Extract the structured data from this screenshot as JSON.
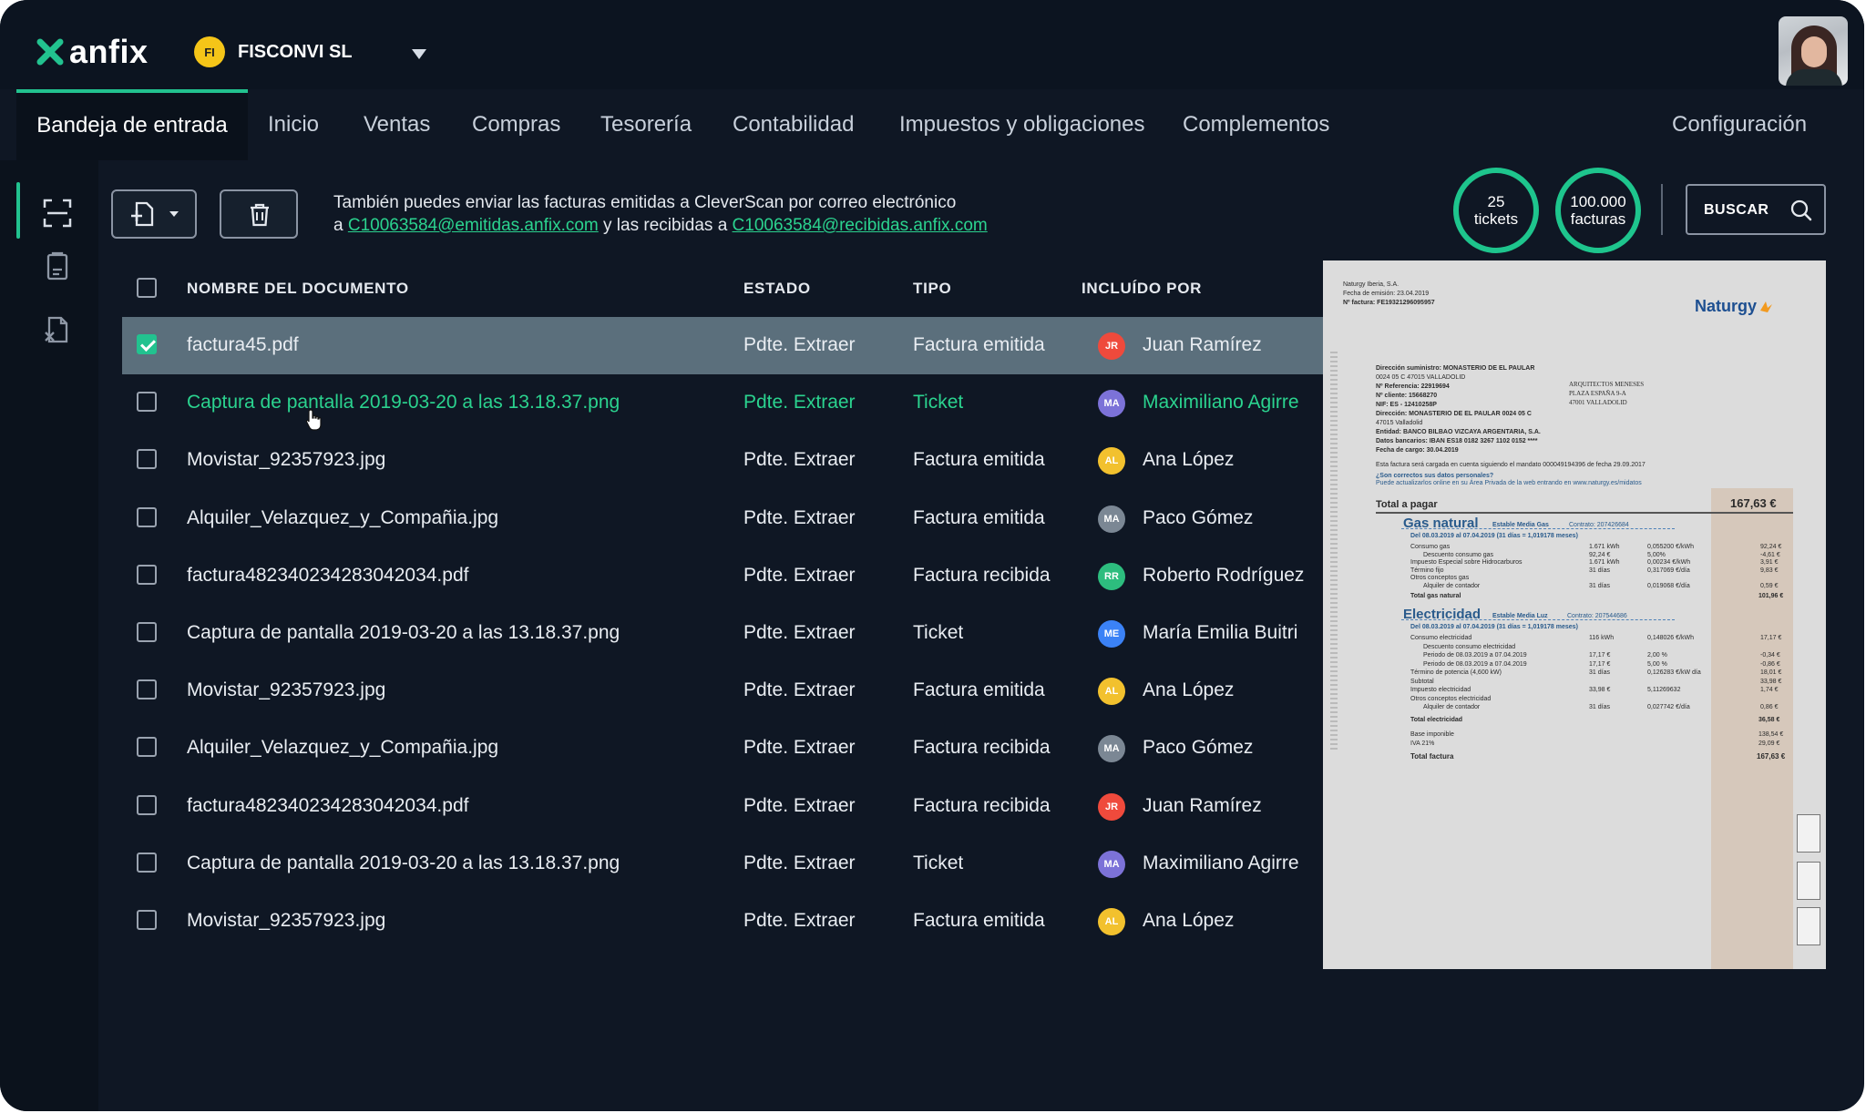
{
  "app": {
    "logo": "anfix",
    "company_badge": "FI",
    "company_name": "FISCONVI SL"
  },
  "nav": {
    "tabs": [
      "Bandeja de entrada",
      "Inicio",
      "Ventas",
      "Compras",
      "Tesorería",
      "Contabilidad",
      "Impuestos y obligaciones",
      "Complementos"
    ],
    "config": "Configuración"
  },
  "toolbar": {
    "info_line1": "También puedes enviar las facturas emitidas a CleverScan por correo electrónico",
    "info_a": "a ",
    "email_emitidas": "C10063584@emitidas.anfix.com",
    "info_mid": " y las recibidas a ",
    "email_recibidas": "C10063584@recibidas.anfix.com"
  },
  "counters": {
    "tickets_value": "25",
    "tickets_label": "tickets",
    "facturas_value": "100.000",
    "facturas_label": "facturas"
  },
  "search": {
    "label": "BUSCAR"
  },
  "table": {
    "headers": [
      "NOMBRE DEL DOCUMENTO",
      "ESTADO",
      "TIPO",
      "INCLUÍDO POR"
    ],
    "rows": [
      {
        "name": "factura45.pdf",
        "estado": "Pdte. Extraer",
        "tipo": "Factura emitida",
        "initials": "JR",
        "person": "Juan Ramírez",
        "color": "#ef4a3c"
      },
      {
        "name": "Captura de pantalla 2019-03-20 a las 13.18.37.png",
        "estado": "Pdte. Extraer",
        "tipo": "Ticket",
        "initials": "MA",
        "person": "Maximiliano Agirre",
        "color": "#7c72d8"
      },
      {
        "name": "Movistar_92357923.jpg",
        "estado": "Pdte. Extraer",
        "tipo": "Factura emitida",
        "initials": "AL",
        "person": "Ana López",
        "color": "#f2c12e"
      },
      {
        "name": "Alquiler_Velazquez_y_Compañia.jpg",
        "estado": "Pdte. Extraer",
        "tipo": "Factura emitida",
        "initials": "MA",
        "person": "Paco Gómez",
        "color": "#7b8794"
      },
      {
        "name": "factura482340234283042034.pdf",
        "estado": "Pdte. Extraer",
        "tipo": "Factura recibida",
        "initials": "RR",
        "person": "Roberto Rodríguez",
        "color": "#2dbd7e"
      },
      {
        "name": "Captura de pantalla 2019-03-20 a las 13.18.37.png",
        "estado": "Pdte. Extraer",
        "tipo": "Ticket",
        "initials": "ME",
        "person": "María Emilia Buitri",
        "color": "#3b82f6"
      },
      {
        "name": "Movistar_92357923.jpg",
        "estado": "Pdte. Extraer",
        "tipo": "Factura emitida",
        "initials": "AL",
        "person": "Ana López",
        "color": "#f2c12e"
      },
      {
        "name": "Alquiler_Velazquez_y_Compañia.jpg",
        "estado": "Pdte. Extraer",
        "tipo": "Factura recibida",
        "initials": "MA",
        "person": "Paco Gómez",
        "color": "#7b8794"
      },
      {
        "name": "factura482340234283042034.pdf",
        "estado": "Pdte. Extraer",
        "tipo": "Factura recibida",
        "initials": "JR",
        "person": "Juan Ramírez",
        "color": "#ef4a3c"
      },
      {
        "name": "Captura de pantalla 2019-03-20 a las 13.18.37.png",
        "estado": "Pdte. Extraer",
        "tipo": "Ticket",
        "initials": "MA",
        "person": "Maximiliano Agirre",
        "color": "#7c72d8"
      },
      {
        "name": "Movistar_92357923.jpg",
        "estado": "Pdte. Extraer",
        "tipo": "Factura emitida",
        "initials": "AL",
        "person": "Ana López",
        "color": "#f2c12e"
      }
    ]
  },
  "preview": {
    "issuer": "Naturgy Iberia, S.A.",
    "issue_date": "Fecha de emisión: 23.04.2019",
    "invoice_no": "Nº factura: FE19321296095957",
    "brand": "Naturgy",
    "addr1": "Dirección suministro: MONASTERIO DE EL PAULAR",
    "addr2": "0024 05   C 47015 VALLADOLID",
    "ref": "Nº Referencia: 22919694",
    "client": "Nº cliente: 15668270",
    "nif": "NIF: ES - 12410258P",
    "dir": "Dirección: MONASTERIO DE EL PAULAR 0024 05 C",
    "dir2": "47015 Valladolid",
    "bank": "Entidad: BANCO BILBAO VIZCAYA ARGENTARIA, S.A.",
    "iban": "Datos bancarios: IBAN ES18 0182 3267 1102 0152 ****",
    "charge": "Fecha de cargo: 30.04.2019",
    "recipient1": "ARQUITECTOS MENESES",
    "recipient2": "PLAZA ESPAÑA 9-A",
    "recipient3": "47001 VALLADOLID",
    "mandate": "Esta factura será cargada en cuenta siguiendo el mandato 000049194396 de fecha 29.09.2017",
    "personal1": "¿Son correctos sus datos personales?",
    "personal2": "Puede actualizarlos online en su Área Privada de la web entrando en www.naturgy.es/midatos",
    "total_label": "Total a pagar",
    "total_value": "167,63 €",
    "gas_title": "Gas natural",
    "gas_sub": "Estable Media Gas",
    "gas_contract": "Contrato: 207426684",
    "gas_period": "Del 08.03.2019 al 07.04.2019 (31 días = 1,019178 meses)",
    "gas_lines": [
      {
        "label": "Consumo gas",
        "qty": "1.671 kWh",
        "rate": "0,055200 €/kWh",
        "amount": "92,24 €"
      },
      {
        "label": "Descuento consumo gas",
        "qty": "92,24 €",
        "rate": "5,00%",
        "amount": "-4,61 €"
      },
      {
        "label": "Impuesto Especial sobre Hidrocarburos",
        "qty": "1.671 kWh",
        "rate": "0,00234 €/kWh",
        "amount": "3,91 €"
      },
      {
        "label": "Término fijo",
        "qty": "31 días",
        "rate": "0,317069 €/día",
        "amount": "9,83 €"
      },
      {
        "label": "Otros conceptos gas",
        "qty": "",
        "rate": "",
        "amount": ""
      },
      {
        "label": "Alquiler de contador",
        "qty": "31 días",
        "rate": "0,019068 €/día",
        "amount": "0,59 €"
      }
    ],
    "gas_total_label": "Total gas natural",
    "gas_total": "101,96 €",
    "elec_title": "Electricidad",
    "elec_sub": "Estable Media Luz",
    "elec_contract": "Contrato: 207544686",
    "elec_period": "Del 08.03.2019 al 07.04.2019 (31 días = 1,019178 meses)",
    "elec_lines": [
      {
        "label": "Consumo electricidad",
        "qty": "116 kWh",
        "rate": "0,148026 €/kWh",
        "amount": "17,17 €"
      },
      {
        "label": "Descuento consumo electricidad",
        "qty": "",
        "rate": "",
        "amount": ""
      },
      {
        "label": "Periodo de 08.03.2019 a 07.04.2019",
        "qty": "17,17 €",
        "rate": "2,00 %",
        "amount": "-0,34 €"
      },
      {
        "label": "Periodo de 08.03.2019 a 07.04.2019",
        "qty": "17,17 €",
        "rate": "5,00 %",
        "amount": "-0,86 €"
      },
      {
        "label": "Término de potencia (4,600 kW)",
        "qty": "31 días",
        "rate": "0,126283 €/kW día",
        "amount": "18,01 €"
      },
      {
        "label": "Subtotal",
        "qty": "",
        "rate": "",
        "amount": "33,98 €"
      },
      {
        "label": "Impuesto electricidad",
        "qty": "33,98 €",
        "rate": "5,11269632",
        "amount": "1,74 €"
      },
      {
        "label": "Otros conceptos electricidad",
        "qty": "",
        "rate": "",
        "amount": ""
      },
      {
        "label": "Alquiler de contador",
        "qty": "31 días",
        "rate": "0,027742 €/día",
        "amount": "0,86 €"
      }
    ],
    "elec_total_label": "Total electricidad",
    "elec_total": "36,58 €",
    "base_label": "Base imponible",
    "base_value": "138,54 €",
    "iva_label": "IVA 21%",
    "iva_value": "29,09 €",
    "invoice_total_label": "Total factura",
    "invoice_total": "167,63 €"
  },
  "colors": {
    "accent": "#22c28f",
    "background": "#0f1724",
    "selected_row": "#5b6f7c",
    "link": "#2bd38f"
  }
}
